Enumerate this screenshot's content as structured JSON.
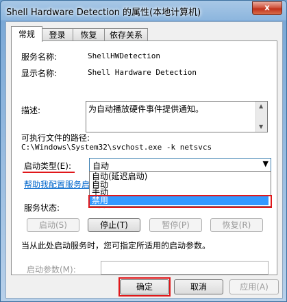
{
  "window": {
    "title": "Shell Hardware Detection 的属性(本地计算机)",
    "close_label": "x"
  },
  "tabs": [
    "常规",
    "登录",
    "恢复",
    "依存关系"
  ],
  "general": {
    "service_name_label": "服务名称:",
    "service_name_value": "ShellHWDetection",
    "display_name_label": "显示名称:",
    "display_name_value": "Shell Hardware Detection",
    "description_label": "描述:",
    "description_value": "为自动播放硬件事件提供通知。",
    "exe_path_label": "可执行文件的路径:",
    "exe_path_value": "C:\\Windows\\System32\\svchost.exe -k netsvcs",
    "startup_type_label": "启动类型(E):",
    "startup_type_value": "自动",
    "startup_options": [
      "自动(延迟启动)",
      "自动",
      "手动",
      "禁用"
    ],
    "selected_option_index": 3,
    "help_link": "帮助我配置服务启",
    "status_label": "服务状态:",
    "status_value": "已启动",
    "start_button": "启动(S)",
    "stop_button": "停止(T)",
    "pause_button": "暂停(P)",
    "resume_button": "恢复(R)",
    "hint_text": "当从此处启动服务时，您可指定所适用的启动参数。",
    "start_params_label": "启动参数(M):"
  },
  "footer": {
    "ok": "确定",
    "cancel": "取消",
    "apply": "应用(A)"
  }
}
